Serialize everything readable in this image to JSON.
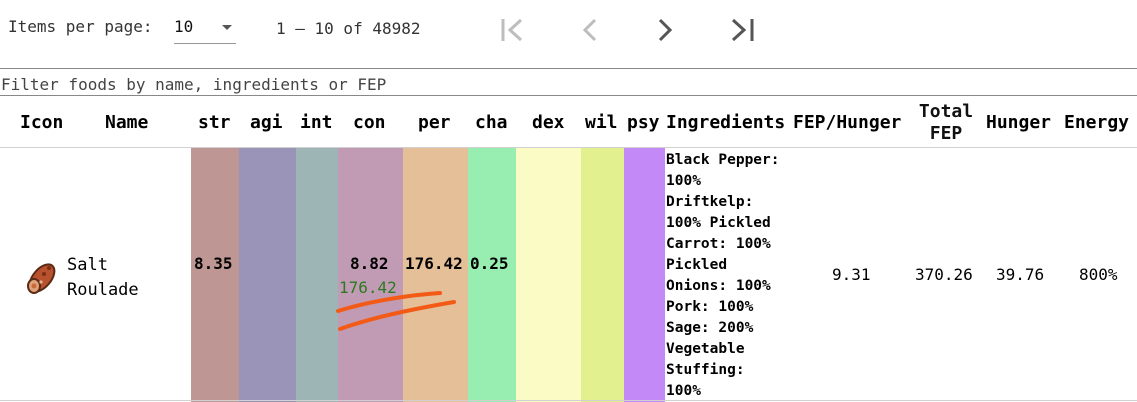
{
  "paginator": {
    "items_per_page_label": "Items per page:",
    "page_size": "10",
    "range_label": "1 – 10 of 48982"
  },
  "filter": {
    "placeholder": "Filter foods by name, ingredients or FEP"
  },
  "columns": {
    "icon": "Icon",
    "name": "Name",
    "str": "str",
    "agi": "agi",
    "int": "int",
    "con": "con",
    "per": "per",
    "cha": "cha",
    "dex": "dex",
    "wil": "wil",
    "psy": "psy",
    "ingredients": "Ingredients",
    "fep_hunger": "FEP/Hunger",
    "total_fep_1": "Total",
    "total_fep_2": "FEP",
    "hunger": "Hunger",
    "energy": "Energy"
  },
  "stat_colors": {
    "str": "#be9693",
    "agi": "#9a94b8",
    "int": "#9eb5b5",
    "con": "#c19bb3",
    "per": "#e5bf98",
    "cha": "#98eeb1",
    "dex": "#fbfbc6",
    "wil": "#e3f08f",
    "psy": "#c38af7"
  },
  "row": {
    "name_line1": "Salt",
    "name_line2": "Roulade",
    "str": "8.35",
    "con": "8.82",
    "per": "176.42",
    "per_highlight": "176.42",
    "cha": "0.25",
    "ingredients": "Black Pepper:\n100%\nDriftkelp:\n100% Pickled\nCarrot: 100%\nPickled\nOnions: 100%\nPork: 100%\nSage: 200%\nVegetable\nStuffing:\n100%",
    "fep_hunger": "9.31",
    "total_fep": "370.26",
    "hunger": "39.76",
    "energy": "800%"
  },
  "icons": {
    "first_page": "first-page-icon",
    "prev_page": "chevron-left-icon",
    "next_page": "chevron-right-icon",
    "last_page": "last-page-icon",
    "food": "salt-roulade-icon"
  }
}
